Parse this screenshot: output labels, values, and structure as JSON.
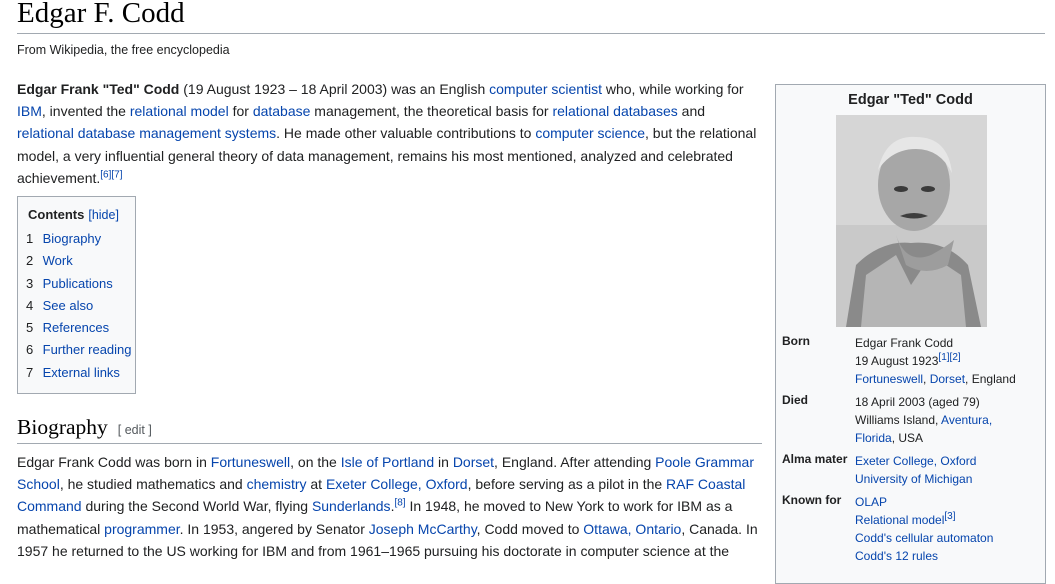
{
  "article": {
    "title": "Edgar F. Codd",
    "tagline": "From Wikipedia, the free encyclopedia"
  },
  "intro": {
    "name_bold": "Edgar Frank \"Ted\" Codd",
    "t1": " (19 August 1923 – 18 April 2003) was an English ",
    "l1": "computer scientist",
    "t2": " who, while working for ",
    "l2": "IBM",
    "t3": ", invented the ",
    "l3": "relational model",
    "t4": " for ",
    "l4": "database",
    "t5": " management, the theoretical basis for ",
    "l5": "relational databases",
    "t6": " and ",
    "l6": "relational database management systems",
    "t7": ". He made other valuable contributions to ",
    "l7": "computer science",
    "t8": ", but the relational model, a very influential general theory of data management, remains his most mentioned, analyzed and celebrated achievement.",
    "ref": "[6][7]"
  },
  "toc": {
    "title": "Contents",
    "toggle": "[hide]",
    "items": [
      {
        "num": "1",
        "label": "Biography"
      },
      {
        "num": "2",
        "label": "Work"
      },
      {
        "num": "3",
        "label": "Publications"
      },
      {
        "num": "4",
        "label": "See also"
      },
      {
        "num": "5",
        "label": "References"
      },
      {
        "num": "6",
        "label": "Further reading"
      },
      {
        "num": "7",
        "label": "External links"
      }
    ]
  },
  "biography": {
    "heading": "Biography",
    "edit": "[ edit ]",
    "t1": "Edgar Frank Codd was born in ",
    "l1": "Fortuneswell",
    "t2": ", on the ",
    "l2": "Isle of Portland",
    "t3": " in ",
    "l3": "Dorset",
    "t4": ", England. After attending ",
    "l4": "Poole Grammar School",
    "t5": ", he studied mathematics and ",
    "l5": "chemistry",
    "t6": " at ",
    "l6": "Exeter College, Oxford",
    "t7": ", before serving as a pilot in the ",
    "l7": "RAF Coastal Command",
    "t8": " during the Second World War, flying ",
    "l8": "Sunderlands",
    "t9": ".",
    "ref1": "[8]",
    "t10": " In 1948, he moved to New York to work for IBM as a mathematical ",
    "l9": "programmer",
    "t11": ". In 1953, angered by Senator ",
    "l10": "Joseph McCarthy",
    "t12": ", Codd moved to ",
    "l11": "Ottawa, Ontario",
    "t13": ", Canada. In 1957 he returned to the US working for IBM and from 1961–1965 pursuing his doctorate in computer science at the"
  },
  "infobox": {
    "title": "Edgar \"Ted\" Codd",
    "photo_icon": "portrait-photo",
    "born_label": "Born",
    "born_name": "Edgar Frank Codd",
    "born_date": "19 August 1923",
    "born_ref": "[1][2]",
    "born_place1": "Fortuneswell",
    "born_comma1": ", ",
    "born_place2": "Dorset",
    "born_place3": ", England",
    "died_label": "Died",
    "died_date": "18 April 2003 (aged 79)",
    "died_place1": "Williams Island, ",
    "died_place2": "Aventura,",
    "died_place3": "Florida",
    "died_place4": ", USA",
    "alma_label": "Alma mater",
    "alma1": "Exeter College, Oxford",
    "alma2": "University of Michigan",
    "known_label": "Known for",
    "known1": "OLAP",
    "known2": "Relational model",
    "known2_ref": "[3]",
    "known3": "Codd's cellular automaton",
    "known4": "Codd's 12 rules"
  }
}
